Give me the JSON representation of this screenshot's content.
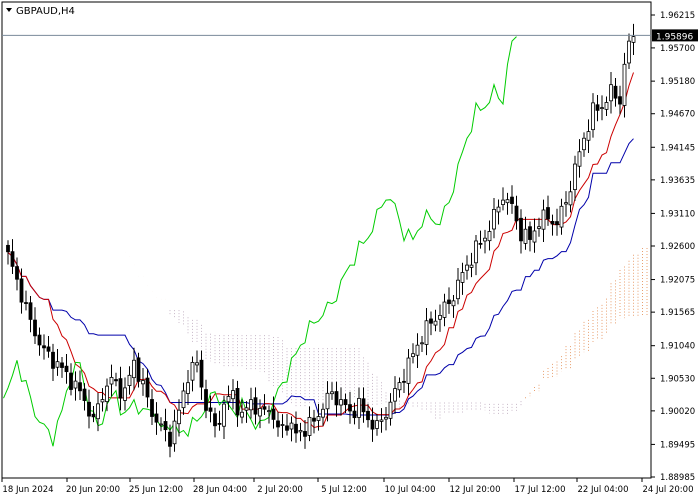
{
  "chart_data": {
    "type": "candlestick",
    "title": "GBPAUD,H4",
    "symbol": "GBPAUD",
    "timeframe": "H4",
    "current_price": "1.95896",
    "y_ticks": [
      "1.96215",
      "1.95700",
      "1.95180",
      "1.94670",
      "1.94145",
      "1.93635",
      "1.93110",
      "1.92600",
      "1.92075",
      "1.91565",
      "1.91040",
      "1.90530",
      "1.90020",
      "1.89495",
      "1.88985"
    ],
    "ylim": [
      1.88985,
      1.96215
    ],
    "x_ticks": [
      "18 Jun 2024",
      "20 Jun 20:00",
      "25 Jun 12:00",
      "28 Jun 04:00",
      "2 Jul 20:00",
      "5 Jul 12:00",
      "10 Jul 04:00",
      "12 Jul 20:00",
      "17 Jul 12:00",
      "22 Jul 04:00",
      "24 Jul 20:00"
    ],
    "bar_count": 140,
    "anchors": [
      [
        0,
        1.9245
      ],
      [
        3,
        1.9185
      ],
      [
        5,
        1.914
      ],
      [
        8,
        1.9095
      ],
      [
        11,
        1.9075
      ],
      [
        14,
        1.905
      ],
      [
        17,
        1.902
      ],
      [
        19,
        1.8985
      ],
      [
        21,
        1.903
      ],
      [
        23,
        1.905
      ],
      [
        26,
        1.903
      ],
      [
        28,
        1.908
      ],
      [
        30,
        1.904
      ],
      [
        32,
        1.9
      ],
      [
        34,
        1.8975
      ],
      [
        36,
        1.896
      ],
      [
        38,
        1.9
      ],
      [
        40,
        1.906
      ],
      [
        42,
        1.9075
      ],
      [
        44,
        1.901
      ],
      [
        46,
        1.8975
      ],
      [
        48,
        1.901
      ],
      [
        50,
        1.903
      ],
      [
        52,
        1.899
      ],
      [
        54,
        1.902
      ],
      [
        56,
        1.8995
      ],
      [
        58,
        1.901
      ],
      [
        60,
        1.897
      ],
      [
        62,
        1.8985
      ],
      [
        64,
        1.8965
      ],
      [
        66,
        1.8975
      ],
      [
        68,
        1.8985
      ],
      [
        70,
        1.901
      ],
      [
        72,
        1.903
      ],
      [
        74,
        1.9015
      ],
      [
        76,
        1.9
      ],
      [
        78,
        1.901
      ],
      [
        80,
        1.899
      ],
      [
        82,
        1.8975
      ],
      [
        84,
        1.9
      ],
      [
        86,
        1.903
      ],
      [
        88,
        1.906
      ],
      [
        90,
        1.909
      ],
      [
        92,
        1.912
      ],
      [
        94,
        1.914
      ],
      [
        96,
        1.9155
      ],
      [
        98,
        1.917
      ],
      [
        100,
        1.92
      ],
      [
        102,
        1.923
      ],
      [
        104,
        1.9255
      ],
      [
        106,
        1.9275
      ],
      [
        108,
        1.9305
      ],
      [
        110,
        1.934
      ],
      [
        112,
        1.932
      ],
      [
        114,
        1.928
      ],
      [
        116,
        1.927
      ],
      [
        118,
        1.93
      ],
      [
        120,
        1.9305
      ],
      [
        122,
        1.9295
      ],
      [
        124,
        1.933
      ],
      [
        126,
        1.938
      ],
      [
        128,
        1.943
      ],
      [
        130,
        1.947
      ],
      [
        132,
        1.948
      ],
      [
        134,
        1.95
      ],
      [
        136,
        1.949
      ],
      [
        137,
        1.954
      ],
      [
        138,
        1.9575
      ],
      [
        139,
        1.959
      ]
    ],
    "series": [
      {
        "role": "tenkan_sen",
        "color": "#cc0000"
      },
      {
        "role": "kijun_sen",
        "color": "#0000aa"
      },
      {
        "role": "chikou_span",
        "color": "#00cc00"
      },
      {
        "role": "cloud_bullish",
        "color": "#e8a070"
      },
      {
        "role": "cloud_bearish",
        "color": "#c8b8c8"
      }
    ],
    "candle_color": "#000000",
    "price_line_color": "#7a8a9a",
    "grid": false
  }
}
